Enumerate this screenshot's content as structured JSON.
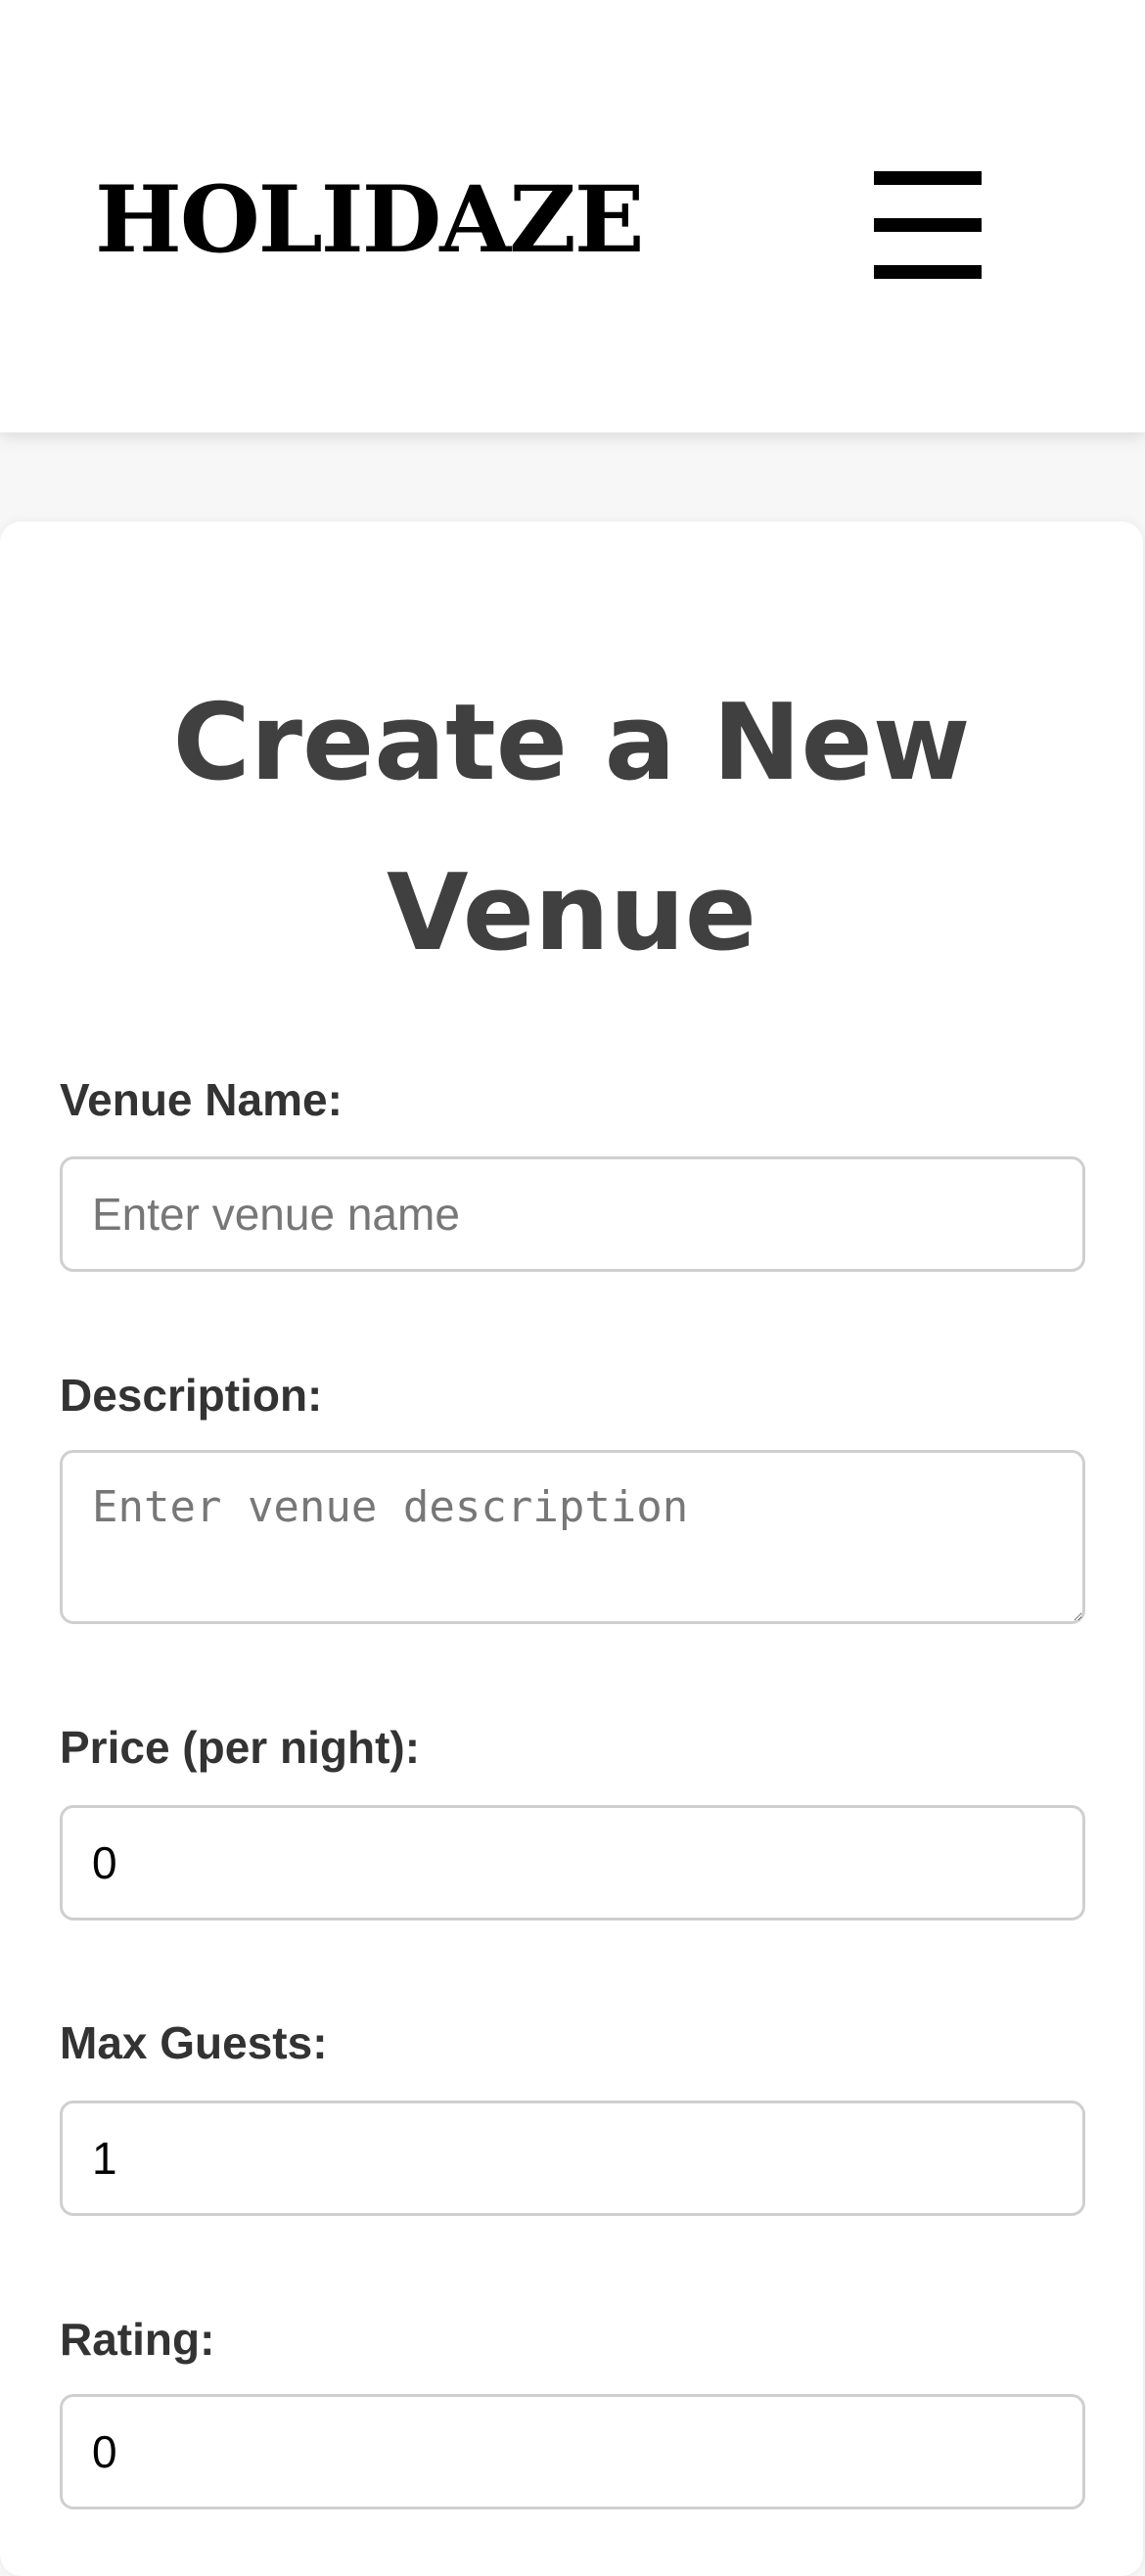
{
  "header": {
    "logo": "HOLIDAZE",
    "menu_icon": "hamburger-menu-icon"
  },
  "form": {
    "title": "Create a New Venue",
    "venue_name": {
      "label": "Venue Name:",
      "placeholder": "Enter venue name",
      "value": ""
    },
    "description": {
      "label": "Description:",
      "placeholder": "Enter venue description",
      "value": ""
    },
    "price": {
      "label": "Price (per night):",
      "value": "0"
    },
    "max_guests": {
      "label": "Max Guests:",
      "value": "1"
    },
    "rating": {
      "label": "Rating:",
      "value": "0"
    }
  }
}
